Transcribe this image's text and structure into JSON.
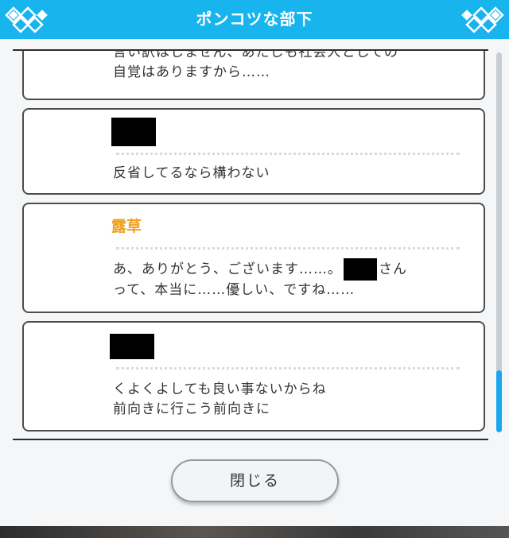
{
  "header": {
    "title": "ポンコツな部下"
  },
  "messages": [
    {
      "speaker": "",
      "lines": [
        "言い訳はしません、あたしも社会人としての",
        "自覚はありますから……"
      ]
    },
    {
      "speaker": "",
      "lines": [
        "反省してるなら構わない"
      ]
    },
    {
      "speaker": "露草",
      "line1_before": "あ、ありがとう、ございます……。",
      "line1_after": "さん",
      "line2": "って、本当に……優しい、ですね……"
    },
    {
      "speaker": "",
      "lines": [
        "くよくよしても良い事ないからね",
        "前向きに行こう前向きに"
      ]
    }
  ],
  "close_button": {
    "label": "閉じる"
  },
  "colors": {
    "header": "#18b4ee",
    "speaker": "#f0a01e",
    "scroll_thumb": "#18a7f0"
  }
}
